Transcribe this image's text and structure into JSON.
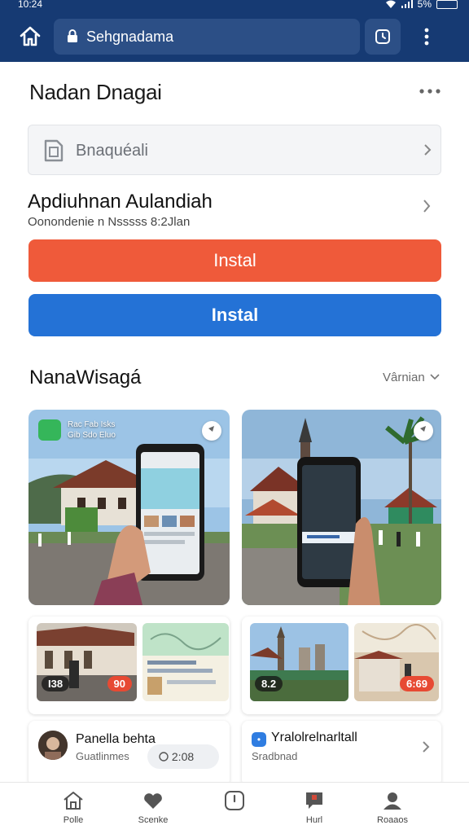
{
  "status": {
    "time": "10:24",
    "battery": "5%"
  },
  "browser": {
    "url": "Sehgnadama"
  },
  "page": {
    "title": "Nadan Dnagai"
  },
  "search": {
    "placeholder": "Bnaquéali"
  },
  "app": {
    "name": "Apdiuhnan Aulandiah",
    "subtitle": "Oonondenie n Nsssss 8:2Jlan"
  },
  "buttons": {
    "primary": "Instal",
    "secondary": "Instal"
  },
  "section": {
    "title": "NanaWisagá",
    "filter": "Vârnian"
  },
  "photo_overlay": {
    "line1": "Rac Fab Isks",
    "line2": "Gib Sdo Eluo"
  },
  "thumbs": {
    "left_a": "I38",
    "left_b": "90",
    "right_a": "8.2",
    "right_b": "6:69"
  },
  "posts": {
    "left": {
      "name": "Panella behta",
      "sub": "Guatlinmes",
      "chip": "2:08"
    },
    "right": {
      "name": "Yralolrelnarltall",
      "sub": "Sradbnad"
    }
  },
  "nav": [
    {
      "label": "Polle",
      "icon": "home-icon"
    },
    {
      "label": "Scenke",
      "icon": "heart-icon"
    },
    {
      "label": "",
      "icon": "clock-icon"
    },
    {
      "label": "Hurl",
      "icon": "chat-icon"
    },
    {
      "label": "Roaaos",
      "icon": "person-icon"
    }
  ],
  "colors": {
    "topbar": "#163a73",
    "red_button": "#ef5a3a",
    "blue_button": "#2472d6"
  }
}
